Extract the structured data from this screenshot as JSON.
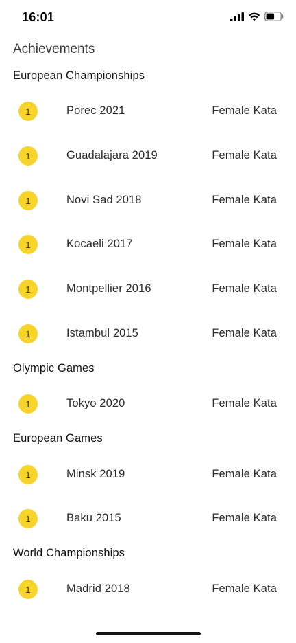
{
  "status_bar": {
    "time": "16:01"
  },
  "page": {
    "title": "Achievements"
  },
  "sections": [
    {
      "title": "European Championships",
      "items": [
        {
          "medal": "1",
          "event": "Porec 2021",
          "category": "Female Kata"
        },
        {
          "medal": "1",
          "event": "Guadalajara 2019",
          "category": "Female Kata"
        },
        {
          "medal": "1",
          "event": "Novi Sad 2018",
          "category": "Female Kata"
        },
        {
          "medal": "1",
          "event": "Kocaeli 2017",
          "category": "Female Kata"
        },
        {
          "medal": "1",
          "event": "Montpellier 2016",
          "category": "Female Kata"
        },
        {
          "medal": "1",
          "event": "Istambul 2015",
          "category": "Female Kata"
        }
      ]
    },
    {
      "title": "Olympic Games",
      "items": [
        {
          "medal": "1",
          "event": "Tokyo 2020",
          "category": "Female Kata"
        }
      ]
    },
    {
      "title": "European Games",
      "items": [
        {
          "medal": "1",
          "event": "Minsk 2019",
          "category": "Female Kata"
        },
        {
          "medal": "1",
          "event": "Baku 2015",
          "category": "Female Kata"
        }
      ]
    },
    {
      "title": "World Championships",
      "items": [
        {
          "medal": "1",
          "event": "Madrid 2018",
          "category": "Female Kata"
        }
      ]
    }
  ],
  "colors": {
    "medal_gold": "#f7d42a",
    "background": "#ffffff",
    "text": "#2c2c2e"
  }
}
